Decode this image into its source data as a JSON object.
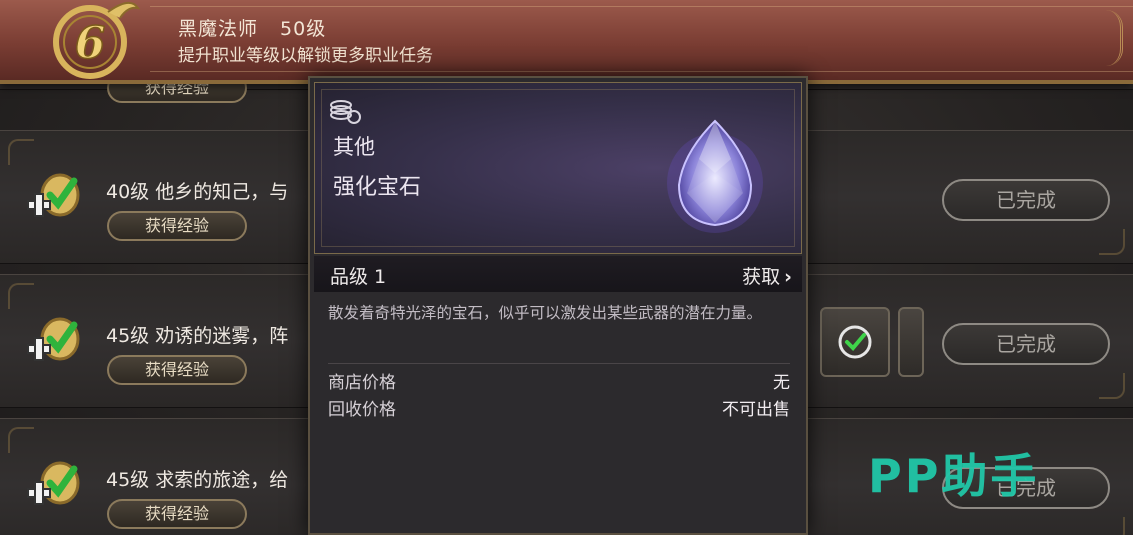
{
  "header": {
    "class_name": "黑魔法师",
    "level": "50级",
    "subtitle": "提升职业等级以解锁更多职业任务",
    "emblem_number": "6"
  },
  "quests": [
    {
      "name": "",
      "exp_label": "获得经验",
      "status": ""
    },
    {
      "name": "40级 他乡的知己，与",
      "exp_label": "获得经验",
      "status": "已完成"
    },
    {
      "name": "45级 劝诱的迷雾，阵",
      "exp_label": "获得经验",
      "status": "已完成"
    },
    {
      "name": "45级 求索的旅途，给",
      "exp_label": "获得经验",
      "status": "已完成"
    }
  ],
  "item_popup": {
    "category": "其他",
    "name": "强化宝石",
    "grade": "品级 1",
    "obtain_label": "获取",
    "obtain_chevron": "›",
    "description": "散发着奇特光泽的宝石，似乎可以激发出某些武器的潜在力量。",
    "shop_price_label": "商店价格",
    "shop_price_value": "无",
    "sell_price_label": "回收价格",
    "sell_price_value": "不可出售"
  },
  "watermark": "PP助手",
  "colors": {
    "header_bg": "#7a3d33",
    "check_green": "#2fb33c",
    "accent_gold": "#c9a24a",
    "watermark": "#21c7a8"
  }
}
